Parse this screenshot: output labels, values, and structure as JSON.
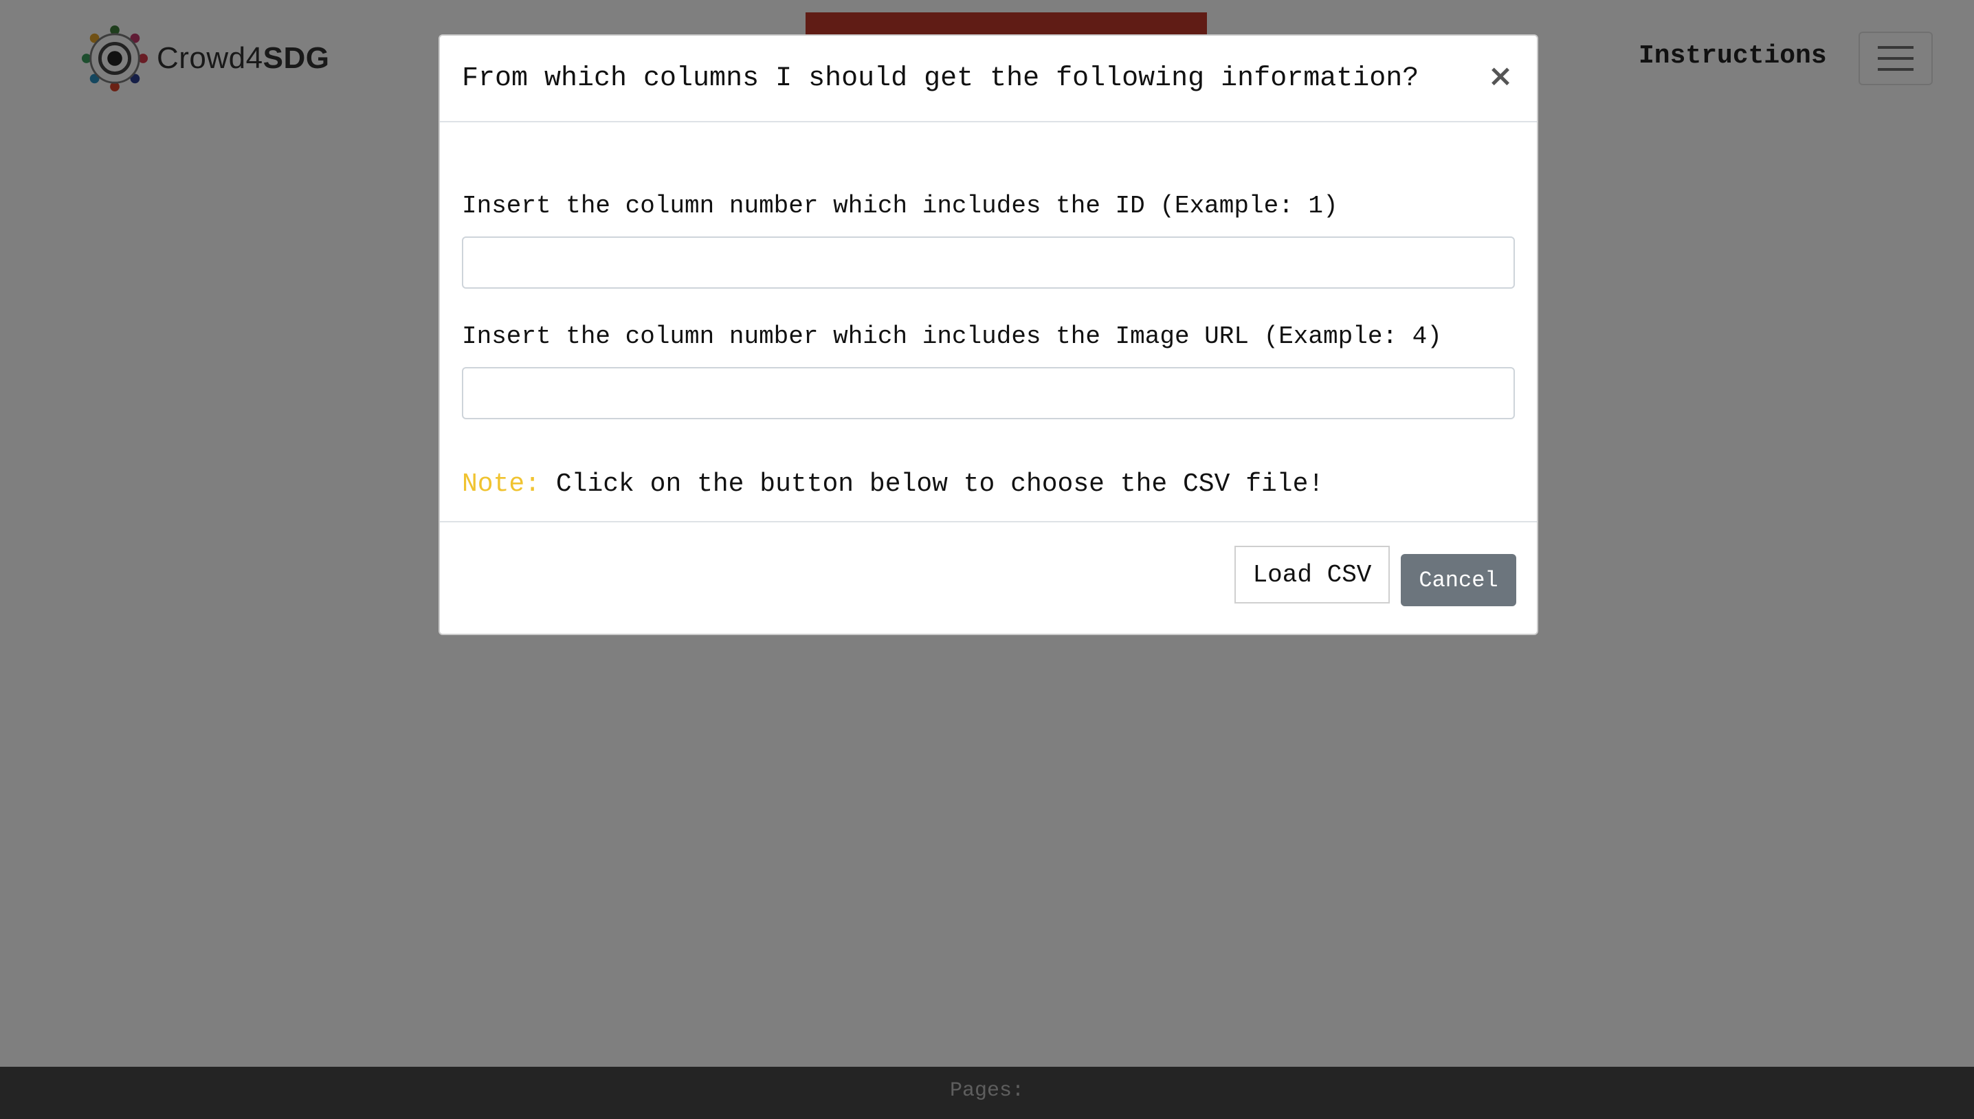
{
  "navbar": {
    "brand_prefix": "Crowd4",
    "brand_suffix": "SDG",
    "instructions_label": "Instructions",
    "menu_icon": "hamburger-menu-icon",
    "banner_color": "#c0392b"
  },
  "footer": {
    "text": "Pages:"
  },
  "modal": {
    "title": "From which columns I should get the following information?",
    "close_label": "×",
    "fields": [
      {
        "label": "Insert the column number which includes the ID (Example: 1)",
        "value": "",
        "placeholder": ""
      },
      {
        "label": "Insert the column number which includes the Image URL (Example: 4)",
        "value": "",
        "placeholder": ""
      }
    ],
    "note_label": "Note:",
    "note_text": " Click on the button below to choose the CSV file!",
    "load_button_label": "Load CSV",
    "cancel_button_label": "Cancel"
  },
  "colors": {
    "note_accent": "#f0c330",
    "cancel_button": "#6c757d",
    "backdrop": "rgba(0,0,0,0.5)"
  }
}
